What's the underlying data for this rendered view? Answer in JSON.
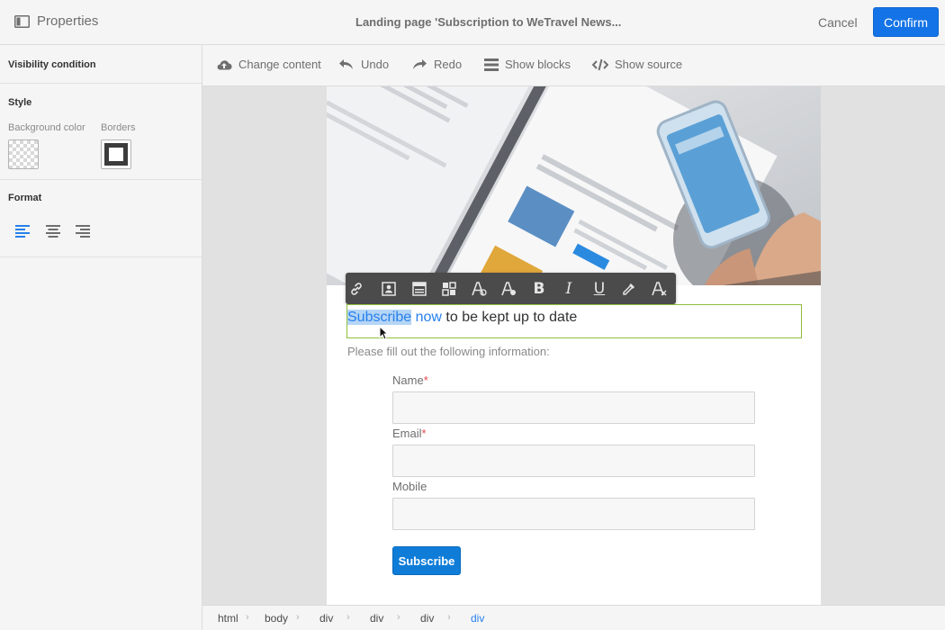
{
  "header": {
    "panel_title": "Properties",
    "doc_title": "Landing page 'Subscription to WeTravel News...",
    "cancel_label": "Cancel",
    "confirm_label": "Confirm"
  },
  "left_panel": {
    "visibility_heading": "Visibility condition",
    "style_heading": "Style",
    "background_color_label": "Background color",
    "borders_label": "Borders",
    "format_heading": "Format",
    "align_selected": "left"
  },
  "toolbar": {
    "change_content": "Change content",
    "undo": "Undo",
    "redo": "Redo",
    "show_blocks": "Show blocks",
    "show_source": "Show source"
  },
  "format_toolbar": {
    "buttons": [
      "link-icon",
      "personalization-icon",
      "content-block-icon",
      "dynamic-content-icon",
      "font-color-icon",
      "background-color-icon",
      "bold-icon",
      "italic-icon",
      "underline-icon",
      "eyedropper-icon",
      "remove-format-icon"
    ],
    "bold_glyph": "B",
    "italic_glyph": "I",
    "underline_glyph": "U"
  },
  "content": {
    "headline_selected": "Subscribe",
    "headline_link_rest": " now",
    "headline_plain": " to be kept up to date",
    "intro": "Please fill out the following information:",
    "fields": [
      {
        "label": "Name",
        "required": "*"
      },
      {
        "label": "Email",
        "required": "*"
      },
      {
        "label": "Mobile",
        "required": ""
      }
    ],
    "subscribe_label": "Subscribe"
  },
  "breadcrumb": [
    "html",
    "body",
    "div",
    "div",
    "div",
    "div"
  ],
  "colors": {
    "accent": "#1473e6",
    "selection": "#b5d5f5",
    "link": "#2680eb",
    "focus_border": "#8fbf3c",
    "required": "#e34850"
  }
}
